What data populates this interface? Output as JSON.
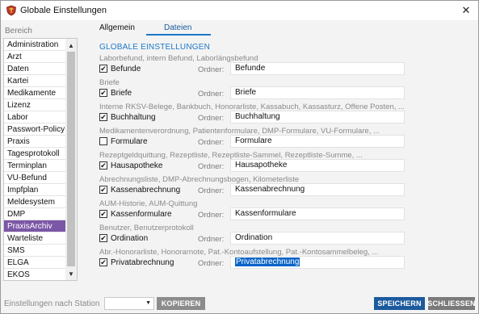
{
  "window": {
    "title": "Globale Einstellungen",
    "close_glyph": "✕"
  },
  "sidebar": {
    "heading": "Bereich",
    "items": [
      "Administration",
      "Arzt",
      "Daten",
      "Kartei",
      "Medikamente",
      "Lizenz",
      "Labor",
      "Passwort-Policy",
      "Praxis",
      "Tagesprotokoll",
      "Terminplan",
      "VU-Befund",
      "Impfplan",
      "Meldesystem",
      "DMP",
      "PraxisArchiv",
      "Warteliste",
      "SMS",
      "ELGA",
      "EKOS"
    ],
    "selected": "PraxisArchiv",
    "scroll_up_glyph": "▲",
    "scroll_down_glyph": "▼"
  },
  "tabs": {
    "allgemein": "Allgemein",
    "dateien": "Dateien",
    "active": "Dateien"
  },
  "content": {
    "heading": "GLOBALE EINSTELLUNGEN",
    "ordner_label": "Ordner:",
    "groups": [
      {
        "desc": "Laborbefund, intern Befund, Laborlängsbefund",
        "label": "Befunde",
        "checked": true,
        "folder": "Befunde"
      },
      {
        "desc": "Briefe",
        "label": "Briefe",
        "checked": true,
        "folder": "Briefe"
      },
      {
        "desc": "Interne RKSV-Belege, Bankbuch, Honorarliste, Kassabuch, Kassasturz, Offene Posten, ...",
        "label": "Buchhaltung",
        "checked": true,
        "folder": "Buchhaltung"
      },
      {
        "desc": "Medikamentenverordnung, Patientenformulare, DMP-Formulare, VU-Formulare, ...",
        "label": "Formulare",
        "checked": false,
        "folder": "Formulare"
      },
      {
        "desc": "Rezeptgeldquittung, Rezeptliste, Rezeptliste-Sammel, Rezeptliste-Summe, ...",
        "label": "Hausapotheke",
        "checked": true,
        "folder": "Hausapotheke"
      },
      {
        "desc": "Abrechnungsliste, DMP-Abrechnungsbogen, Kilometerliste",
        "label": "Kassenabrechnung",
        "checked": true,
        "folder": "Kassenabrechnung"
      },
      {
        "desc": "AUM-Historie, AUM-Quittung",
        "label": "Kassenformulare",
        "checked": true,
        "folder": "Kassenformulare"
      },
      {
        "desc": "Benutzer, Benutzerprotokoll",
        "label": "Ordination",
        "checked": true,
        "folder": "Ordination"
      },
      {
        "desc": "Abr.-Honorarliste, Honorarnote, Pat.-Kontoaufstellung, Pat.-Kontosammelbeleg, ...",
        "label": "Privatabrechnung",
        "checked": true,
        "folder": "Privatabrechnung",
        "folder_selected": true
      }
    ]
  },
  "footer": {
    "station_label": "Einstellungen nach Station",
    "station_value": "",
    "kopieren": "KOPIEREN",
    "speichern": "SPEICHERN",
    "schliessen": "SCHLIESSEN"
  },
  "icons": {
    "app": "red-shield-icon",
    "checkmark": "✔"
  },
  "colors": {
    "accent": "#1c78c8",
    "selected_item": "#7b57a6",
    "primary_button": "#1c5a9e"
  }
}
